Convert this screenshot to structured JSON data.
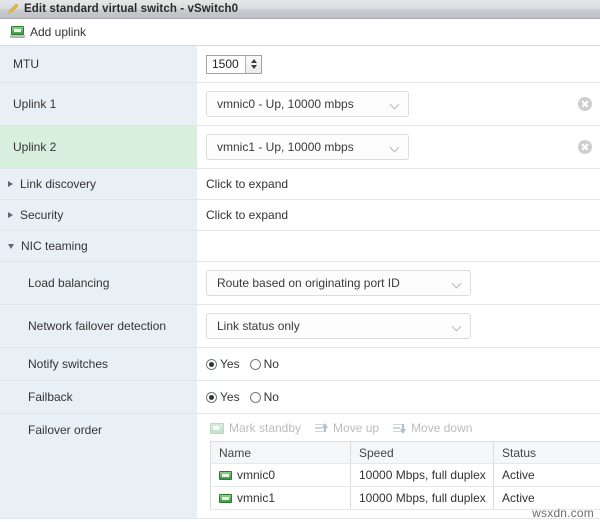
{
  "window": {
    "title": "Edit standard virtual switch - vSwitch0",
    "title_icon": "pencil-edit-icon"
  },
  "toolbar": {
    "add_uplink_label": "Add uplink",
    "add_uplink_icon": "network-adapter-icon"
  },
  "form": {
    "mtu": {
      "label": "MTU",
      "value": "1500"
    },
    "uplink1": {
      "label": "Uplink 1",
      "value": "vmnic0 - Up, 10000 mbps",
      "remove_icon": "remove-circle-icon"
    },
    "uplink2": {
      "label": "Uplink 2",
      "value": "vmnic1 - Up, 10000 mbps",
      "remove_icon": "remove-circle-icon"
    },
    "link_discovery": {
      "label": "Link discovery",
      "expand_text": "Click to expand",
      "expanded": false
    },
    "security": {
      "label": "Security",
      "expand_text": "Click to expand",
      "expanded": false
    },
    "nic_teaming": {
      "label": "NIC teaming",
      "expanded": true
    },
    "load_balancing": {
      "label": "Load balancing",
      "value": "Route based on originating port ID"
    },
    "failover_detection": {
      "label": "Network failover detection",
      "value": "Link status only"
    },
    "notify_switches": {
      "label": "Notify switches",
      "yes_label": "Yes",
      "no_label": "No",
      "selected": "Yes"
    },
    "failback": {
      "label": "Failback",
      "yes_label": "Yes",
      "no_label": "No",
      "selected": "Yes"
    },
    "failover_order": {
      "label": "Failover order",
      "actions": {
        "mark_standby": "Mark standby",
        "move_up": "Move up",
        "move_down": "Move down"
      },
      "columns": [
        "Name",
        "Speed",
        "Status"
      ],
      "rows": [
        {
          "name": "vmnic0",
          "speed": "10000 Mbps, full duplex",
          "status": "Active"
        },
        {
          "name": "vmnic1",
          "speed": "10000 Mbps, full duplex",
          "status": "Active"
        }
      ]
    }
  },
  "watermark": "wsxdn.com",
  "colors": {
    "label_cell": "#e8f0f5",
    "label_cell_new": "#daf0de",
    "accent_green": "#3f9b45",
    "titlebar": "#c9cbcf"
  }
}
